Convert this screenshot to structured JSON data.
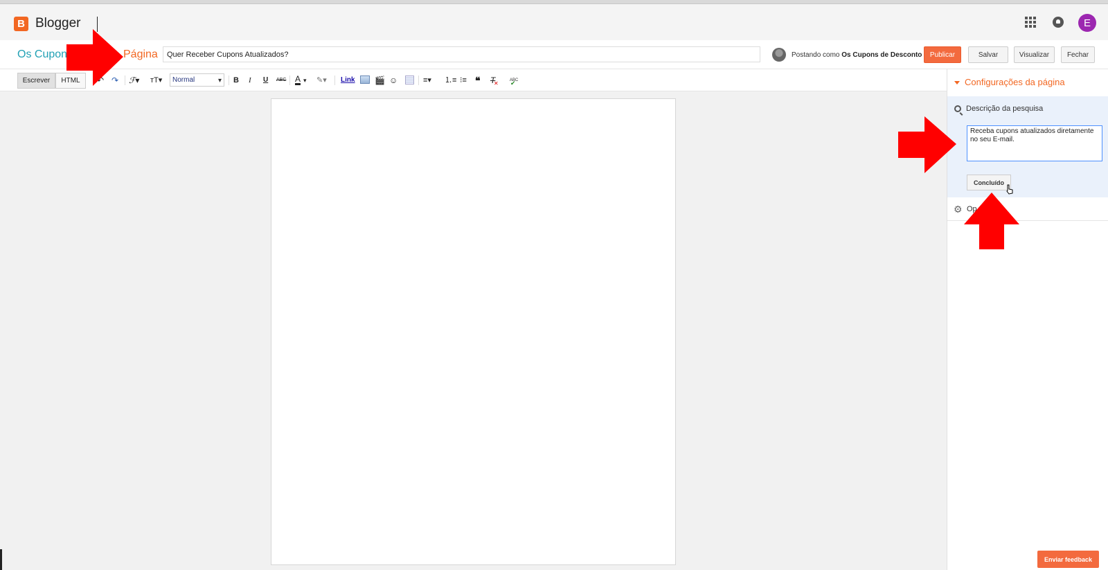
{
  "app": {
    "name": "Blogger",
    "avatar_letter": "E",
    "brand_color": "#f26722",
    "avatar_color": "#9c27b0"
  },
  "icons": {
    "logo": "blogger-logo-icon",
    "apps": "apps-grid-icon",
    "notifications": "bell-icon"
  },
  "post_header": {
    "blog_name_visible": "Os Cupons",
    "crumb_visible": "Página",
    "title_value": "Quer Receber Cupons Atualizados?",
    "posting_as_prefix": "Postando como",
    "posting_as_name": "Os Cupons de Desconto",
    "buttons": {
      "publish": "Publicar",
      "save": "Salvar",
      "preview": "Visualizar",
      "close": "Fechar"
    }
  },
  "toolbar": {
    "mode_write": "Escrever",
    "mode_html": "HTML",
    "format_value": "Normal",
    "bold": "B",
    "italic": "I",
    "underline": "U",
    "strike": "ABC",
    "font_color": "A",
    "link": "Link",
    "spell": "ABC"
  },
  "sidebar": {
    "heading": "Configurações da página",
    "search_description_title": "Descrição da pesquisa",
    "search_description_value": "Receba cupons atualizados diretamente no seu E-mail.",
    "done_button": "Concluído",
    "options_label_visible": "Op"
  },
  "feedback_button": "Enviar feedback",
  "annotation_color": "#ff0000"
}
